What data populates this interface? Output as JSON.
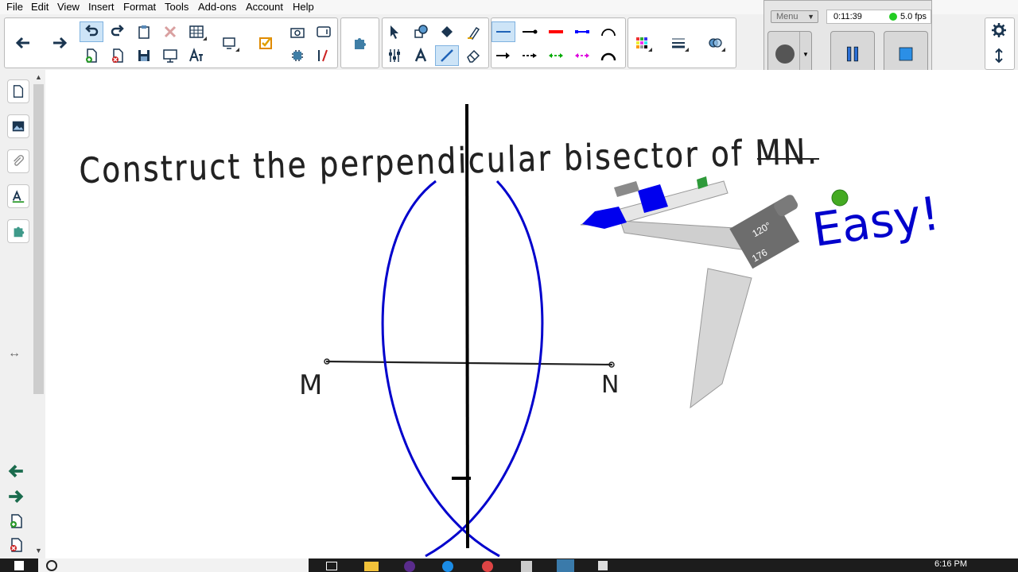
{
  "menubar": {
    "items": [
      "File",
      "Edit",
      "View",
      "Insert",
      "Format",
      "Tools",
      "Add-ons",
      "Account",
      "Help"
    ]
  },
  "toolbar": {
    "groups": [
      "navigation",
      "file-and-page",
      "select-and-shapes",
      "lines",
      "properties"
    ],
    "line_colors": {
      "red": "#ff0000",
      "blue": "#0000ff",
      "green": "#00aa00",
      "magenta": "#dd00dd"
    }
  },
  "recorder": {
    "menu_label": "Menu",
    "elapsed": "0:11:39",
    "fps": "5.0 fps",
    "status_color": "#22cc22"
  },
  "canvas": {
    "handwriting": {
      "prompt": "Construct the perpendicular bisector of MN.",
      "exclaim": "Easy!",
      "point_m": "M",
      "point_n": "N"
    },
    "compass": {
      "angle": "120°",
      "radius": "176",
      "handle_color": "#0000ee",
      "knob_color": "#44aa22"
    },
    "ink_colors": {
      "arcs": "#0000cc",
      "bisector": "#000000"
    }
  },
  "taskbar": {
    "time": "6:16 PM"
  },
  "colors": {
    "accent_blue": "#1f63b8",
    "nav_green": "#1a6b4d",
    "selection": "#cde4f7"
  }
}
